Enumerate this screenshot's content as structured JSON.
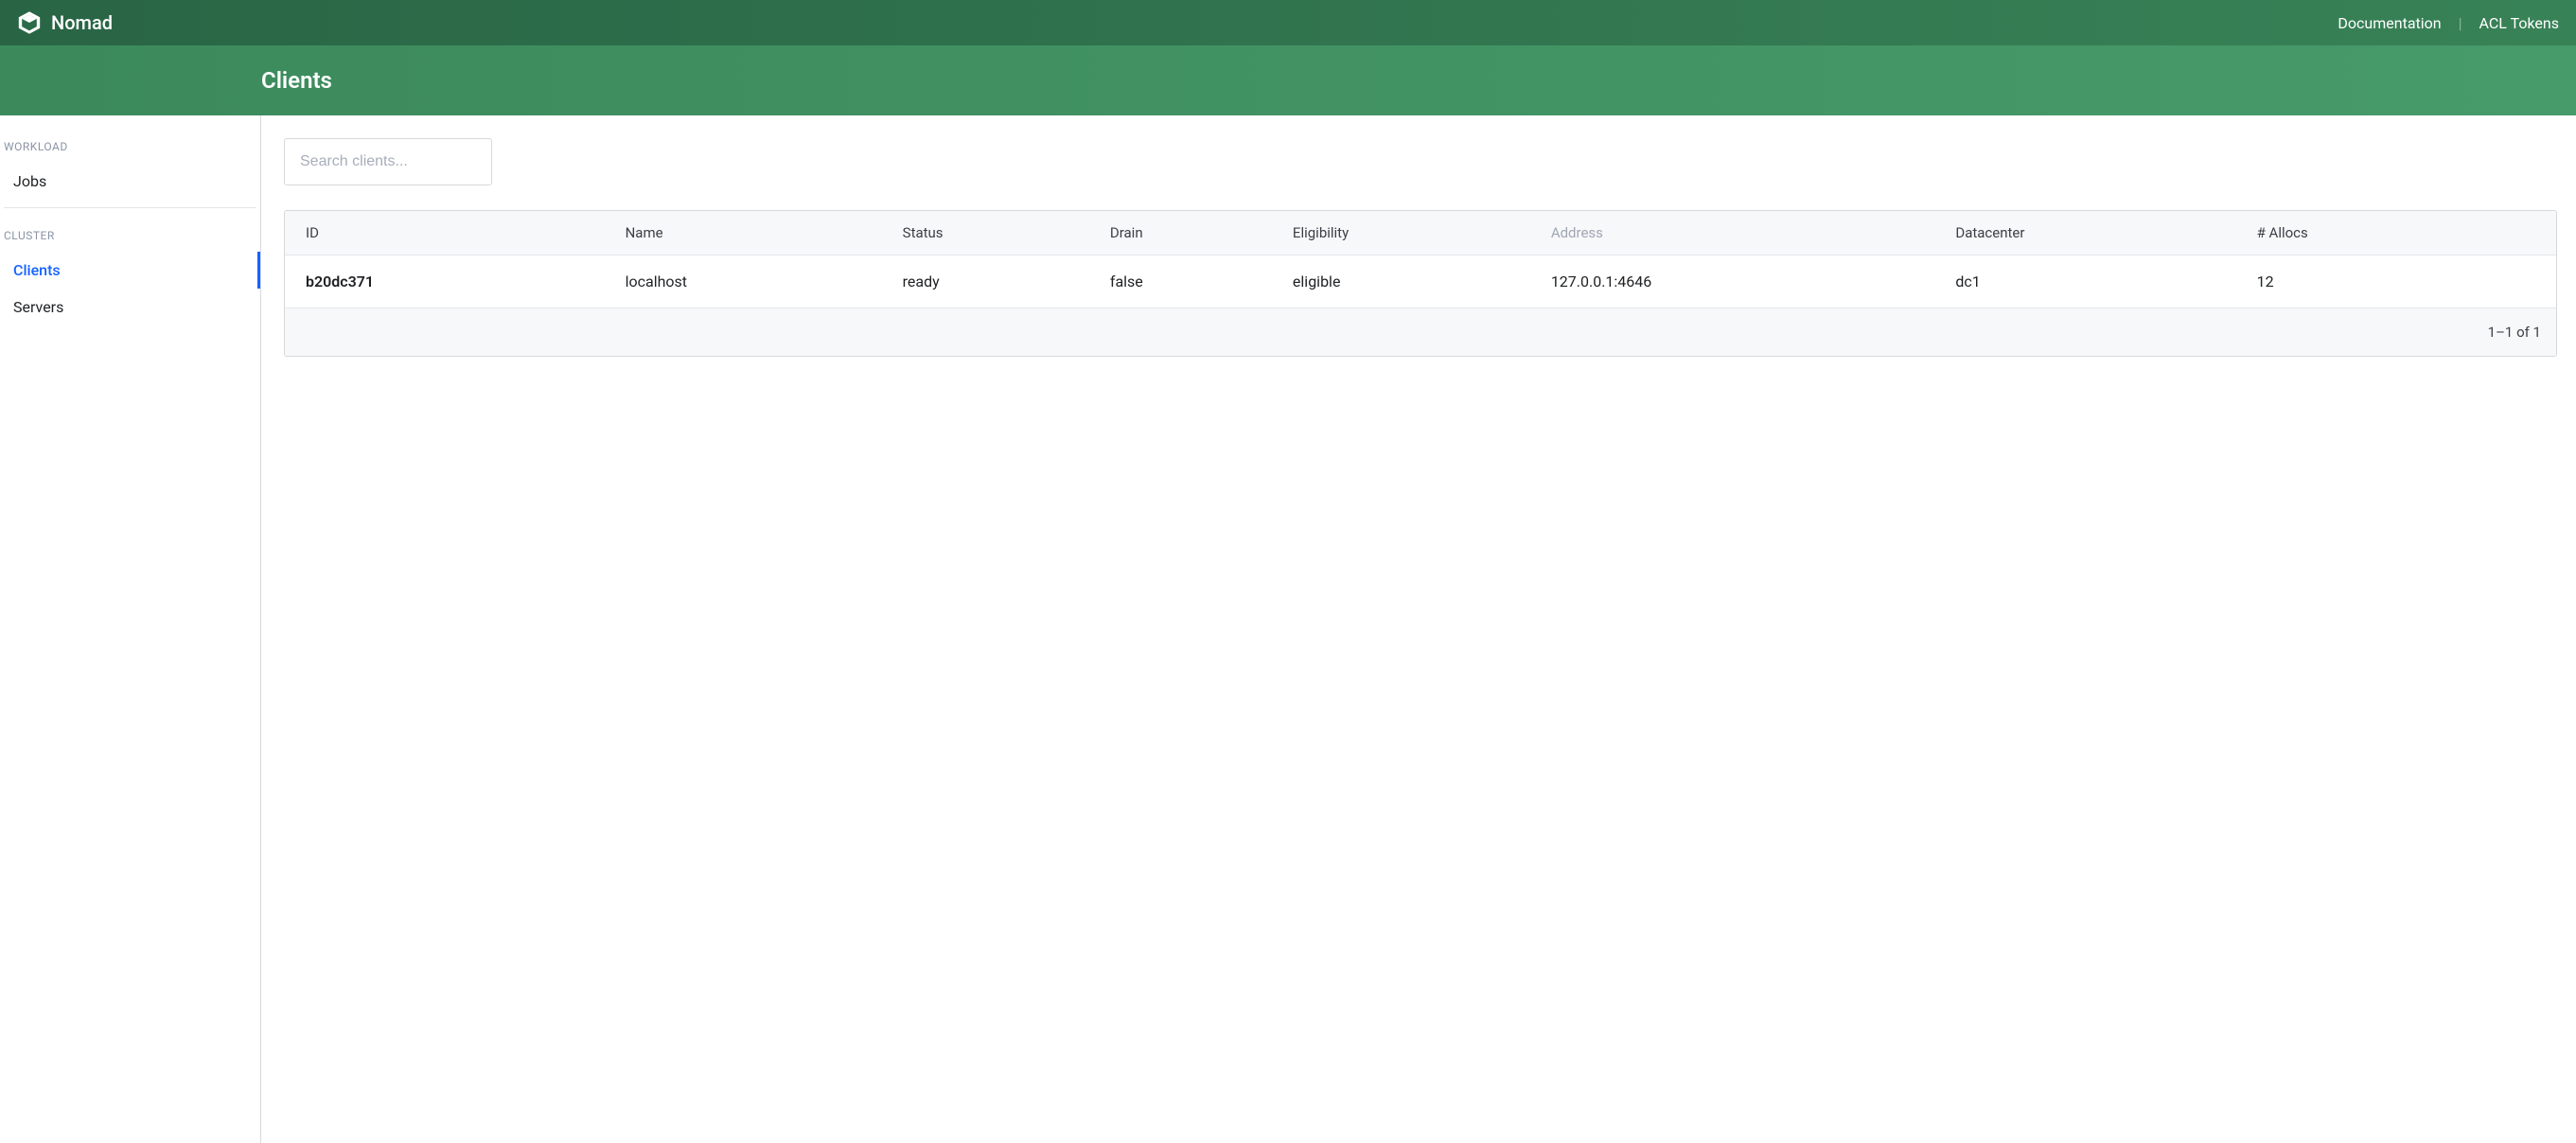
{
  "brand": {
    "name": "Nomad"
  },
  "topnav": {
    "documentation": "Documentation",
    "acl_tokens": "ACL Tokens"
  },
  "page": {
    "title": "Clients"
  },
  "sidebar": {
    "section_workload": "WORKLOAD",
    "section_cluster": "CLUSTER",
    "items": {
      "jobs": "Jobs",
      "clients": "Clients",
      "servers": "Servers"
    }
  },
  "search": {
    "placeholder": "Search clients..."
  },
  "table": {
    "columns": {
      "id": "ID",
      "name": "Name",
      "status": "Status",
      "drain": "Drain",
      "eligibility": "Eligibility",
      "address": "Address",
      "datacenter": "Datacenter",
      "allocs": "# Allocs"
    },
    "rows": [
      {
        "id": "b20dc371",
        "name": "localhost",
        "status": "ready",
        "drain": "false",
        "eligibility": "eligible",
        "address": "127.0.0.1:4646",
        "datacenter": "dc1",
        "allocs": "12"
      }
    ],
    "footer": "1–1 of 1"
  }
}
